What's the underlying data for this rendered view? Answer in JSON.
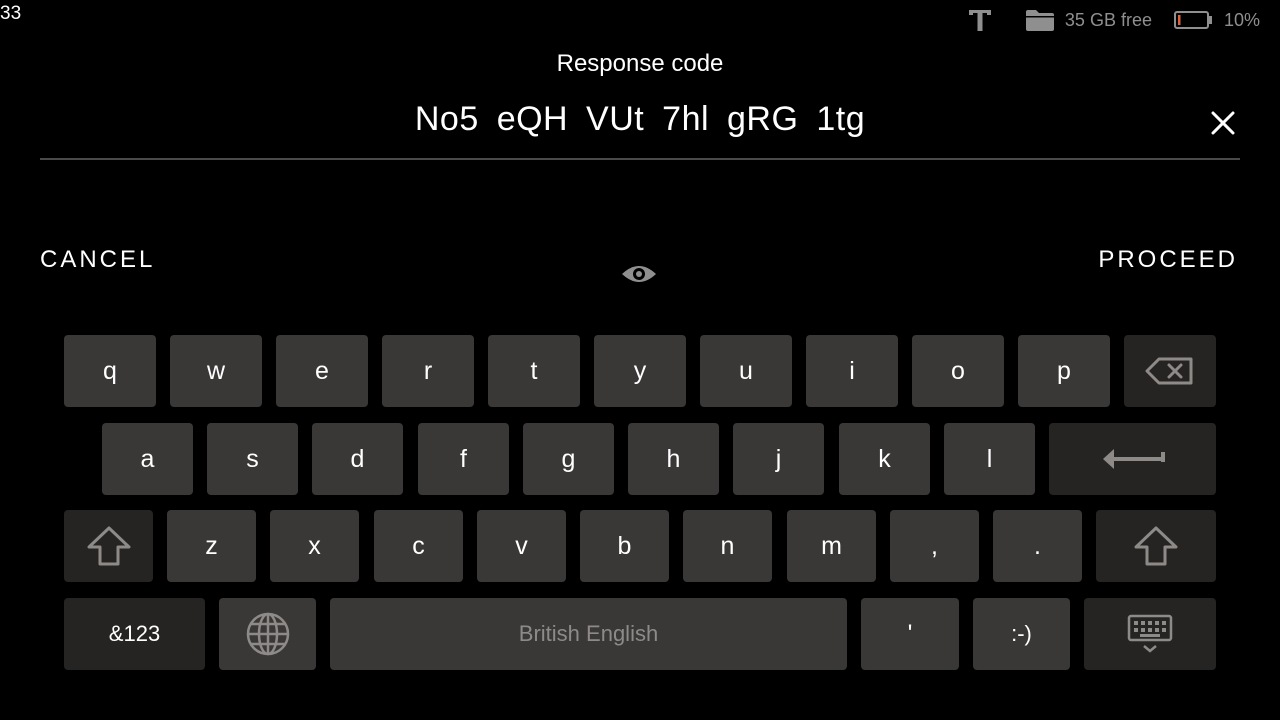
{
  "status_bar": {
    "clock": "33",
    "storage": "35 GB free",
    "battery": "10%",
    "icons": [
      "font-icon",
      "folder-icon",
      "battery-icon"
    ]
  },
  "dialog": {
    "title": "Response code",
    "code_value": "No5 eQH VUt 7hl gRG 1tg",
    "cancel_label": "CANCEL",
    "proceed_label": "PROCEED"
  },
  "keyboard": {
    "row1": [
      "q",
      "w",
      "e",
      "r",
      "t",
      "y",
      "u",
      "i",
      "o",
      "p"
    ],
    "row2": [
      "a",
      "s",
      "d",
      "f",
      "g",
      "h",
      "j",
      "k",
      "l"
    ],
    "row3": [
      "z",
      "x",
      "c",
      "v",
      "b",
      "n",
      "m",
      ",",
      "."
    ],
    "symbols_label": "&123",
    "space_label": "British English",
    "apostrophe_label": "'",
    "smiley_label": ":-)"
  },
  "colors": {
    "background": "#000000",
    "key": "#3a3837",
    "function_key": "#262422",
    "icon_grey": "#8f8f8f"
  }
}
